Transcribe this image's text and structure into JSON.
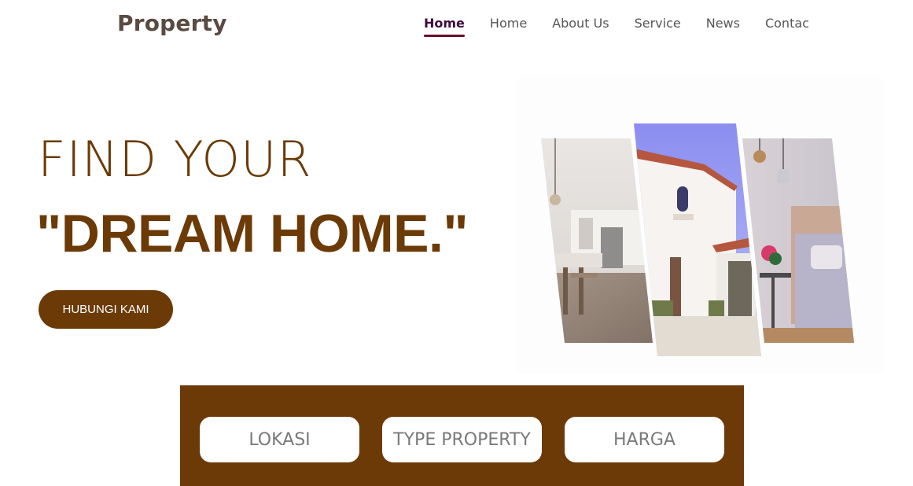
{
  "header": {
    "logo": "Property",
    "nav": [
      {
        "label": "Home",
        "active": true
      },
      {
        "label": "Home",
        "active": false
      },
      {
        "label": "About Us",
        "active": false
      },
      {
        "label": "Service",
        "active": false
      },
      {
        "label": "News",
        "active": false
      },
      {
        "label": "Contac",
        "active": false
      }
    ]
  },
  "hero": {
    "line1": "FIND YOUR",
    "line2": "\"DREAM HOME.\"",
    "cta_label": "HUBUNGI KAMI"
  },
  "collage": {
    "images": [
      "kitchen-interior",
      "white-house-exterior",
      "bedroom-interior"
    ]
  },
  "search": {
    "filters": [
      "LOKASI",
      "TYPE PROPERTY",
      "HARGA"
    ]
  },
  "colors": {
    "brand": "#6b3a06",
    "nav_active": "#3d0a3d",
    "nav_underline": "#6b0f2a",
    "logo": "#5a4a42"
  }
}
